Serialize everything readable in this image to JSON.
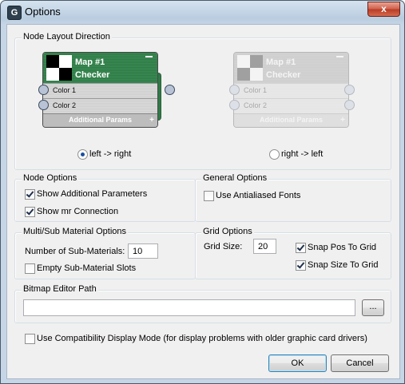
{
  "window": {
    "title": "Options",
    "app_icon": "G",
    "close_glyph": "x"
  },
  "node_layout": {
    "title": "Node Layout Direction",
    "node": {
      "title_line1": "Map #1",
      "title_line2": "Checker",
      "minimize_glyph": "–",
      "rows": [
        "Color 1",
        "Color 2"
      ],
      "footer": "Additional Params",
      "footer_glyph": "+"
    },
    "left_option": {
      "label": "left -> right",
      "selected": true
    },
    "right_option": {
      "label": "right -> left",
      "selected": false
    }
  },
  "node_options": {
    "title": "Node Options",
    "show_additional": {
      "label": "Show Additional Parameters",
      "checked": true
    },
    "show_mr": {
      "label": "Show mr Connection",
      "checked": true
    }
  },
  "general_options": {
    "title": "General Options",
    "antialiased": {
      "label": "Use Antialiased Fonts",
      "checked": false
    }
  },
  "multi_sub": {
    "title": "Multi/Sub Material Options",
    "num_label": "Number of Sub-Materials:",
    "num_value": "10",
    "empty_slots": {
      "label": "Empty Sub-Material Slots",
      "checked": false
    }
  },
  "grid_options": {
    "title": "Grid Options",
    "size_label": "Grid Size:",
    "size_value": "20",
    "snap_pos": {
      "label": "Snap Pos To Grid",
      "checked": true
    },
    "snap_size": {
      "label": "Snap Size To Grid",
      "checked": true
    }
  },
  "bitmap": {
    "title": "Bitmap Editor Path",
    "path_value": "",
    "browse_label": "..."
  },
  "compat": {
    "label": "Use Compatibility Display Mode (for display problems with older graphic card drivers)",
    "checked": false
  },
  "buttons": {
    "ok": "OK",
    "cancel": "Cancel"
  },
  "colors": {
    "node_header": "#2f7a47",
    "title_bar": "#b9cde0",
    "close_button": "#c94a33"
  }
}
